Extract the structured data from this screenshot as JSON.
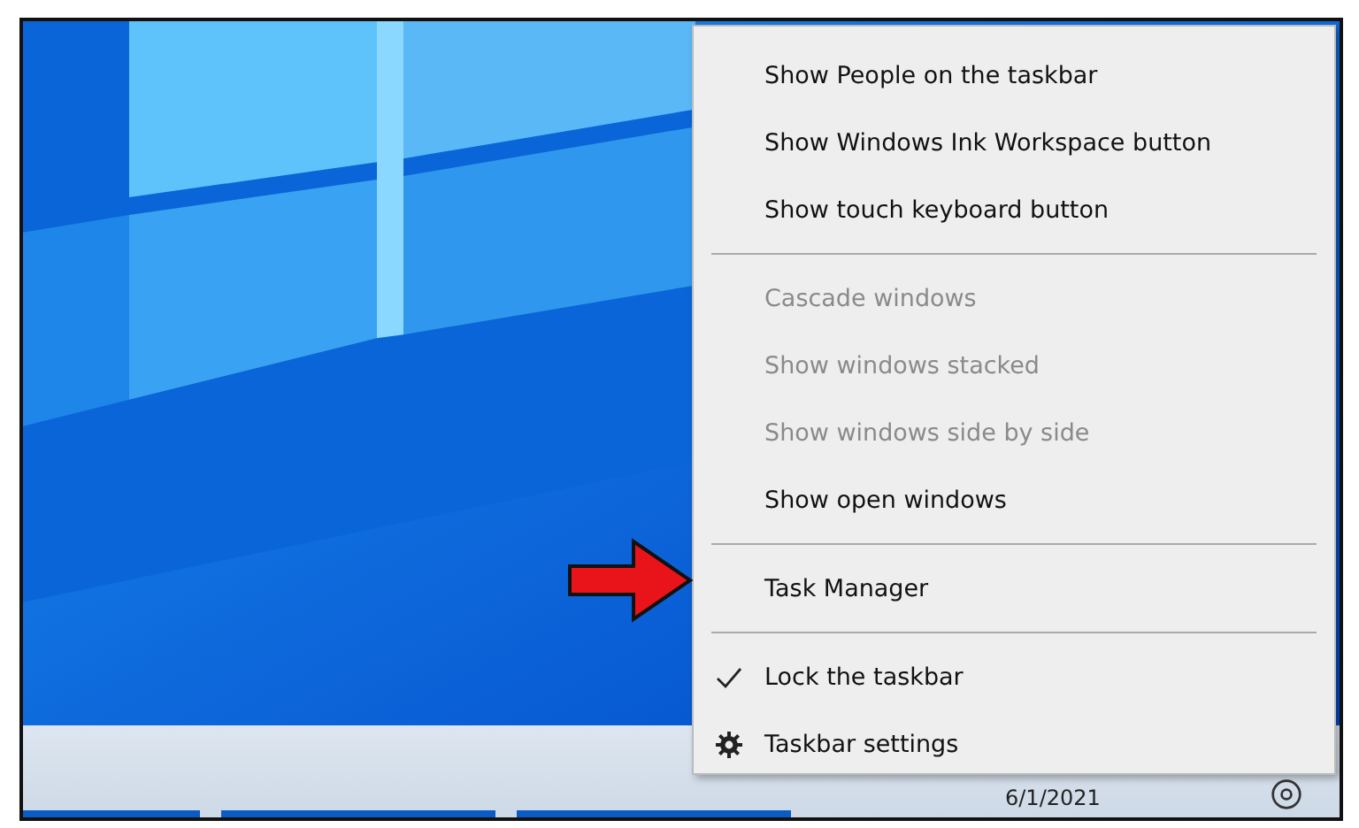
{
  "taskbar": {
    "date": "6/1/2021",
    "buttons": [
      {
        "selected": true
      },
      {
        "selected": true
      },
      {
        "selected": true
      }
    ]
  },
  "context_menu": {
    "items": [
      {
        "kind": "item",
        "label": "Show People on the taskbar",
        "disabled": false,
        "checked": false
      },
      {
        "kind": "item",
        "label": "Show Windows Ink Workspace button",
        "disabled": false,
        "checked": false
      },
      {
        "kind": "item",
        "label": "Show touch keyboard button",
        "disabled": false,
        "checked": false
      },
      {
        "kind": "separator"
      },
      {
        "kind": "item",
        "label": "Cascade windows",
        "disabled": true,
        "checked": false
      },
      {
        "kind": "item",
        "label": "Show windows stacked",
        "disabled": true,
        "checked": false
      },
      {
        "kind": "item",
        "label": "Show windows side by side",
        "disabled": true,
        "checked": false
      },
      {
        "kind": "item",
        "label": "Show open windows",
        "disabled": false,
        "checked": false
      },
      {
        "kind": "separator"
      },
      {
        "kind": "item",
        "label": "Task Manager",
        "disabled": false,
        "checked": false,
        "pointed": true
      },
      {
        "kind": "separator"
      },
      {
        "kind": "item",
        "label": "Lock the taskbar",
        "disabled": false,
        "checked": true
      },
      {
        "kind": "settings",
        "label": "Taskbar settings",
        "disabled": false,
        "checked": false
      }
    ]
  }
}
